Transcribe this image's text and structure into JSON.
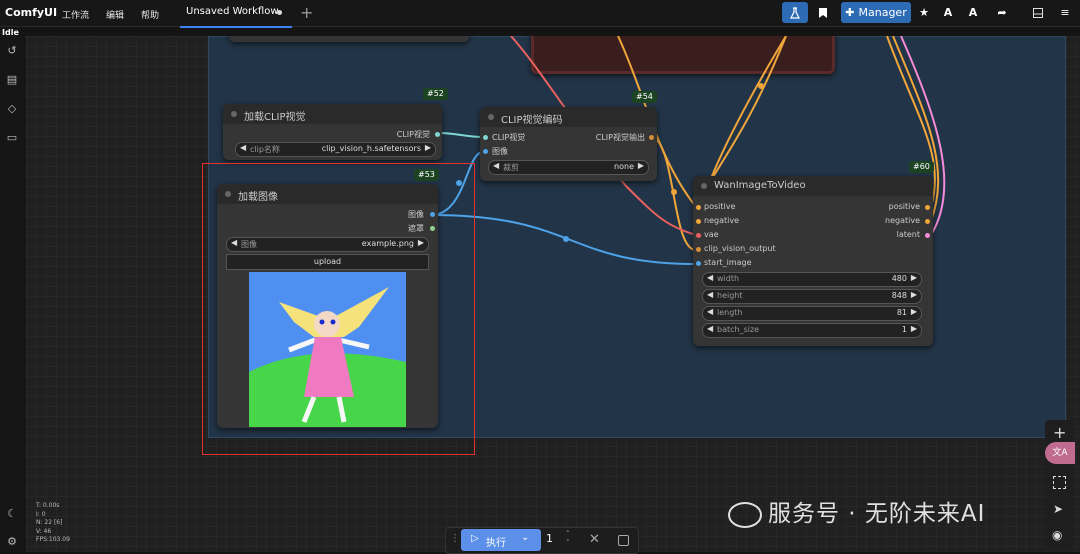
{
  "app": {
    "name": "ComfyUI",
    "status": "Idle"
  },
  "menu": [
    "工作流",
    "编辑",
    "帮助"
  ],
  "tab": {
    "title": "Unsaved Workflow",
    "new_tab": "+"
  },
  "toolbar": {
    "manager_label": "Manager"
  },
  "nodes": {
    "load_clip_vision": {
      "id": "#52",
      "title": "加载CLIP视觉",
      "output": "CLIP视觉",
      "widget_label": "clip名称",
      "widget_value": "clip_vision_h.safetensors"
    },
    "clip_vision_encode": {
      "id": "#54",
      "title": "CLIP视觉编码",
      "inputs": [
        "CLIP视觉",
        "图像"
      ],
      "output": "CLIP视觉输出",
      "widget_label": "裁剪",
      "widget_value": "none"
    },
    "load_image": {
      "id": "#53",
      "title": "加载图像",
      "outputs": [
        "图像",
        "遮罩"
      ],
      "widget_label": "图像",
      "widget_value": "example.png",
      "upload_label": "upload"
    },
    "wan_image_to_video": {
      "id": "#60",
      "title": "WanImageToVideo",
      "inputs": [
        "positive",
        "negative",
        "vae",
        "clip_vision_output",
        "start_image"
      ],
      "outputs": [
        "positive",
        "negative",
        "latent"
      ],
      "widgets": [
        {
          "label": "width",
          "value": "480"
        },
        {
          "label": "height",
          "value": "848"
        },
        {
          "label": "length",
          "value": "81"
        },
        {
          "label": "batch_size",
          "value": "1"
        }
      ]
    }
  },
  "stats": [
    "T: 0.00s",
    "I: 0",
    "N: 22 [6]",
    "V: 46",
    "FPS:103.09"
  ],
  "run": {
    "label": "执行",
    "count": "1"
  },
  "watermark": "服务号 · 无阶未来AI",
  "colors": {
    "accent": "#3b82f6",
    "group_bg": "#223447",
    "highlight": "#e3322b",
    "wire_clip": "#7fd6d6",
    "wire_image": "#4ea3e8",
    "wire_cond": "#f0a63a",
    "wire_vae": "#e8605f",
    "wire_latent": "#f48bd6"
  }
}
